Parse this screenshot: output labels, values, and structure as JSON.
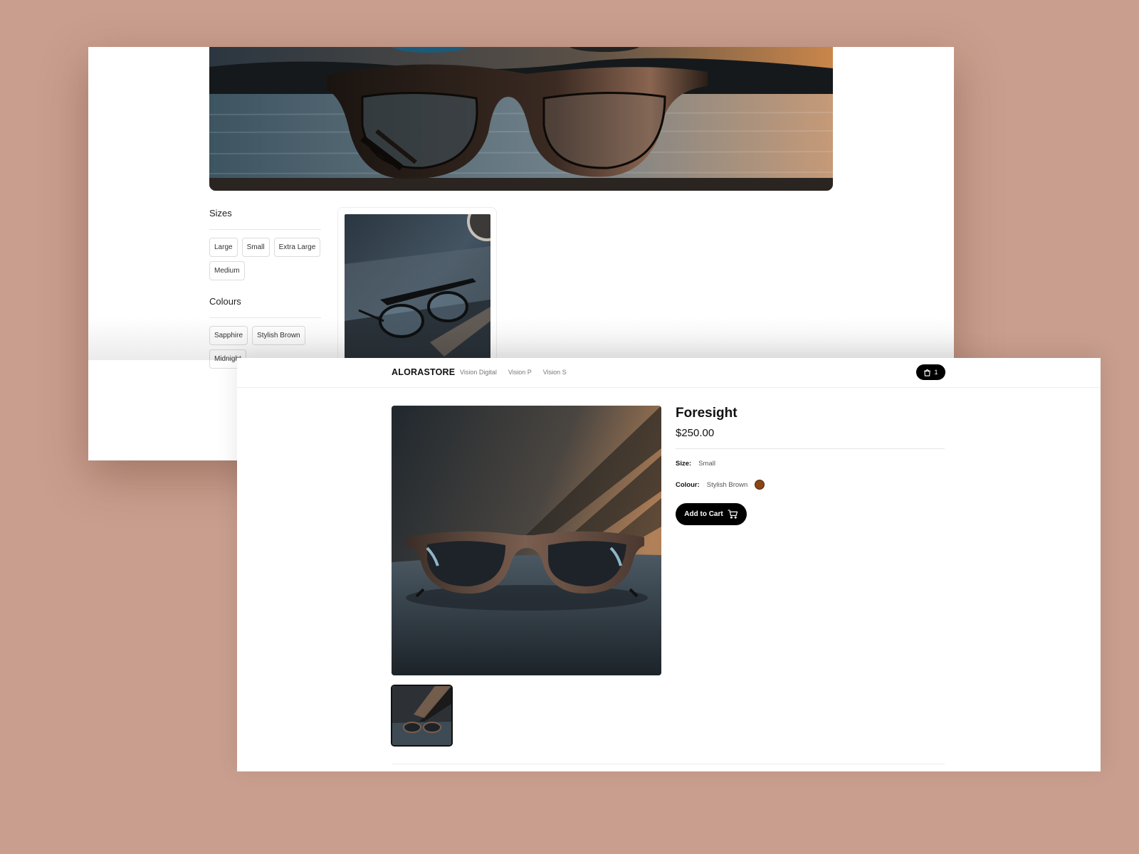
{
  "back_window": {
    "filters": {
      "sizes_title": "Sizes",
      "sizes": [
        "Large",
        "Small",
        "Extra Large",
        "Medium"
      ],
      "colours_title": "Colours",
      "colours": [
        "Sapphire",
        "Stylish Brown",
        "Midnight"
      ]
    }
  },
  "front_window": {
    "nav": {
      "brand": "ALORASTORE",
      "links": [
        "Vision Digital",
        "Vision P",
        "Vision S"
      ],
      "cart_count": "1"
    },
    "product": {
      "title": "Foresight",
      "price": "$250.00",
      "size_label": "Size:",
      "size_value": "Small",
      "colour_label": "Colour:",
      "colour_value": "Stylish Brown",
      "colour_hex": "#8b4513",
      "add_to_cart": "Add to Cart"
    }
  },
  "colors": {
    "background": "#c99e8e",
    "button": "#000000"
  },
  "icons": [
    "shopping-bag-icon",
    "cart-icon"
  ]
}
